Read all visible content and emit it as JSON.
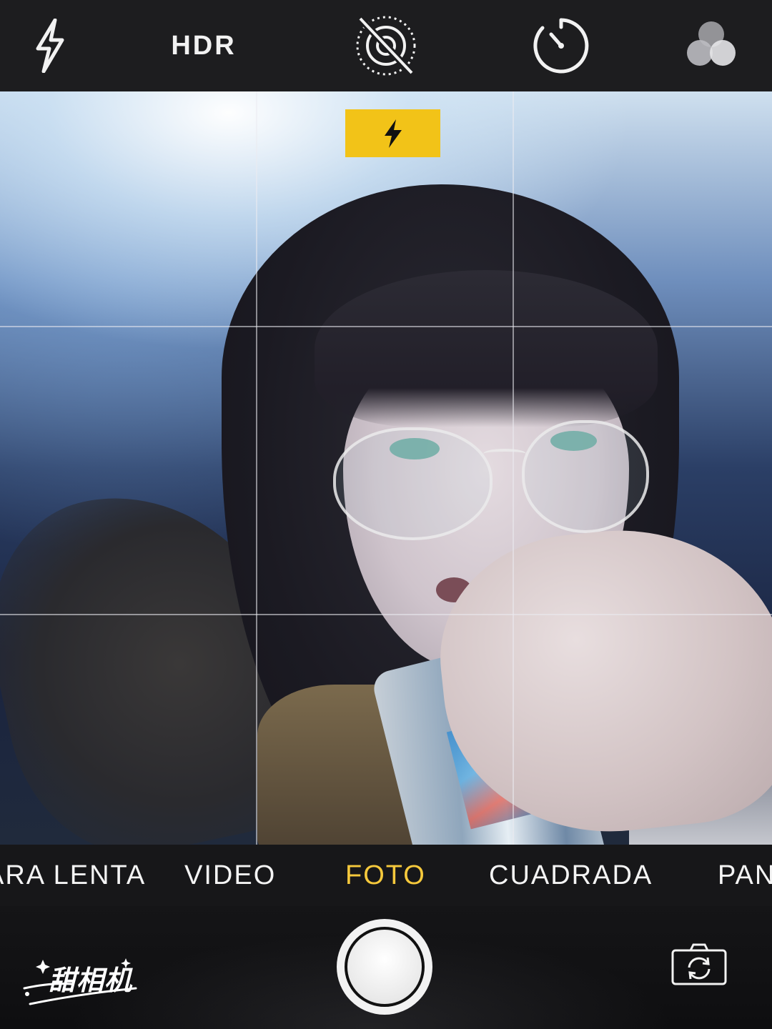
{
  "top_bar": {
    "flash_icon": "flash-icon",
    "hdr_label": "HDR",
    "live_photo_icon": "live-photo-off-icon",
    "timer_icon": "timer-icon",
    "filters_icon": "filters-icon"
  },
  "viewfinder": {
    "flash_indicator_icon": "flash-on-icon",
    "indicator_color": "#f2c318",
    "grid_visible": true
  },
  "modes": {
    "items": [
      "ARA LENTA",
      "VIDEO",
      "FOTO",
      "CUADRADA",
      "PANO"
    ],
    "active": "FOTO",
    "active_color": "#f6c93c"
  },
  "bottom_bar": {
    "shutter_icon": "shutter-button",
    "switch_camera_icon": "switch-camera-icon",
    "watermark_text": "甜相机"
  }
}
